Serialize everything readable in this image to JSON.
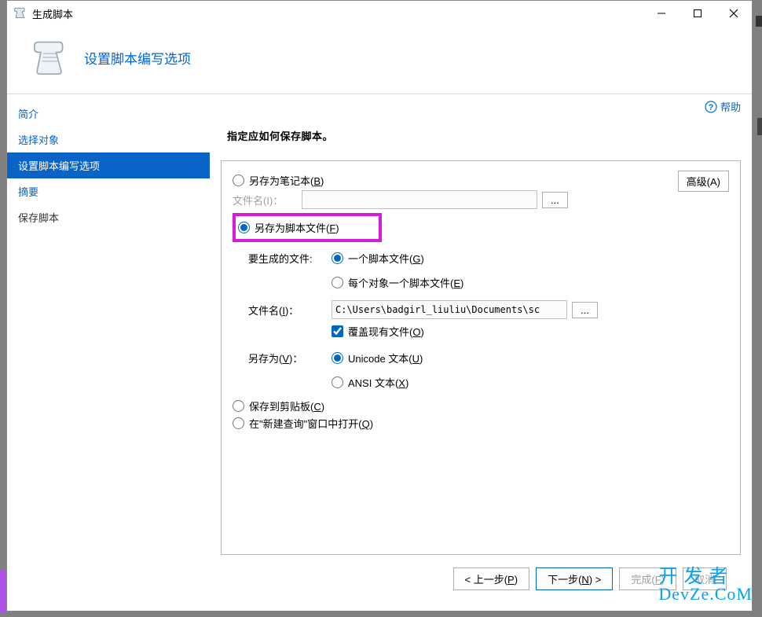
{
  "window": {
    "title": "生成脚本"
  },
  "header": {
    "title": "设置脚本编写选项"
  },
  "help": {
    "label": "帮助"
  },
  "sidebar": {
    "items": [
      {
        "label": "简介"
      },
      {
        "label": "选择对象"
      },
      {
        "label": "设置脚本编写选项"
      },
      {
        "label": "摘要"
      },
      {
        "label": "保存脚本"
      }
    ]
  },
  "main": {
    "instruction": "指定应如何保存脚本。",
    "advanced_btn": "高级(A)",
    "opt_notebook": "另存为笔记本(B)",
    "filename_label_disabled": "文件名(I)：",
    "browse": "...",
    "opt_scriptfile": "另存为脚本文件(F)",
    "files_to_generate": "要生成的文件:",
    "one_script": "一个脚本文件(G)",
    "per_object": "每个对象一个脚本文件(E)",
    "filename_label": "文件名(I)：",
    "filename_value": "C:\\Users\\badgirl_liuliu\\Documents\\sc",
    "overwrite": "覆盖现有文件(O)",
    "save_as": "另存为(V)：",
    "unicode": "Unicode 文本(U)",
    "ansi": "ANSI 文本(X)",
    "opt_clipboard": "保存到剪贴板(C)",
    "opt_newquery": "在\"新建查询\"窗口中打开(Q)"
  },
  "footer": {
    "prev": "< 上一步(P)",
    "next": "下一步(N) >",
    "finish": "完成(F)",
    "cancel": "取消"
  },
  "watermark": {
    "l1": "开发者",
    "l2": "DevZe.CoM"
  }
}
